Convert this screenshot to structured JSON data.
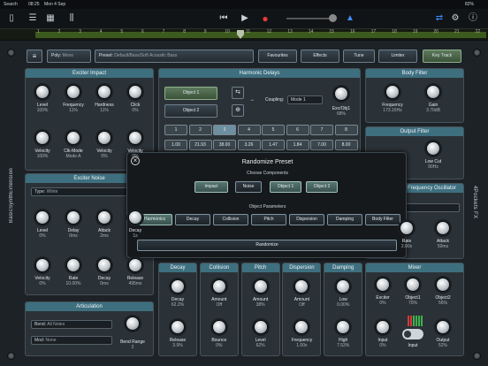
{
  "status": {
    "back": "Search",
    "time": "08:25",
    "date": "Mon 4 Sep",
    "battery": "82%"
  },
  "host": {
    "icons": [
      "document-icon",
      "list-icon",
      "mixer-icon",
      "sliders-icon",
      "rewind-icon",
      "play-icon",
      "record-icon",
      "metronome-icon",
      "wifi-icon",
      "settings-icon",
      "info-icon"
    ]
  },
  "timeline": {
    "ticks": [
      "1",
      "2",
      "3",
      "4",
      "5",
      "6",
      "7",
      "8",
      "9",
      "10",
      "11",
      "12",
      "13",
      "14",
      "15",
      "16",
      "17",
      "18",
      "19",
      "20",
      "21",
      "22"
    ]
  },
  "side": {
    "left": "BasicSynthExtension",
    "right": "4Pockets FX"
  },
  "topbar": {
    "menu": "≡",
    "poly": "Poly:",
    "poly_val": "Mono",
    "preset": "Preset:",
    "preset_val": "Default/Bass/Soft Acoustic Bass",
    "favourites": "Favourites",
    "effects": "Effects",
    "tune": "Tune",
    "limiter": "Limiter",
    "keytrack": "Key Track"
  },
  "exciter_impact": {
    "title": "Exciter Impact",
    "row1": [
      {
        "name": "Level",
        "val": "100%"
      },
      {
        "name": "Frequency",
        "val": "11%"
      },
      {
        "name": "Hardness",
        "val": "11%"
      },
      {
        "name": "Click",
        "val": "0%"
      }
    ],
    "row2": [
      {
        "name": "Velocity",
        "val": "100%"
      },
      {
        "name": "Clk-Mode",
        "val": "Mode A"
      },
      {
        "name": "Velocity",
        "val": "0%"
      },
      {
        "name": "Velocity",
        "val": "0%"
      }
    ]
  },
  "exciter_noise": {
    "title": "Exciter Noise",
    "type_label": "Type:",
    "type_val": "White",
    "row1": [
      {
        "name": "Level",
        "val": "0%"
      },
      {
        "name": "Delay",
        "val": "0ms"
      },
      {
        "name": "Attack",
        "val": "2ms"
      },
      {
        "name": "Decay",
        "val": "1s"
      }
    ],
    "row2": [
      {
        "name": "Velocity",
        "val": "0%"
      },
      {
        "name": "Rate",
        "val": "10.00%"
      },
      {
        "name": "Decay",
        "val": "0ms"
      },
      {
        "name": "Release",
        "val": "495ms"
      }
    ]
  },
  "articulation": {
    "title": "Articulation",
    "bend_label": "Bend:",
    "bend_val": "All Notes",
    "mod_label": "Mod:",
    "mod_val": "None",
    "range_name": "Bend Range",
    "range_val": "2"
  },
  "harmonic_delays": {
    "title": "Harmonic Delays",
    "obj1": "Object 1",
    "obj2": "Object 2",
    "coupling": "Coupling:",
    "coupling_val": "Mode 1",
    "exc_name": "Exc/Obj1",
    "exc_val": "68%",
    "nums": [
      "1",
      "2",
      "3",
      "4",
      "5",
      "6",
      "7",
      "8"
    ],
    "vals": [
      "1.00",
      "21.93",
      "38.00",
      "3.26",
      "1.47",
      "1.84",
      "7.00",
      "8.00"
    ]
  },
  "body_filter": {
    "title": "Body Filter",
    "k": [
      {
        "name": "Frequency",
        "val": "173.16Hz"
      },
      {
        "name": "Gain",
        "val": "3.70dB"
      }
    ]
  },
  "output_filter": {
    "title": "Output Filter",
    "k": {
      "name": "Low Cut",
      "val": "90Hz"
    }
  },
  "freq_osc": {
    "title": "Frequency Oscillator",
    "k": [
      {
        "name": "Rate",
        "val": "2.00x"
      },
      {
        "name": "Attack",
        "val": "50ms"
      }
    ]
  },
  "lower": [
    {
      "title": "Decay",
      "k": [
        {
          "name": "Decay",
          "val": "62.2%"
        },
        {
          "name": "Release",
          "val": "3.9%"
        }
      ]
    },
    {
      "title": "Collision",
      "k": [
        {
          "name": "Amount",
          "val": "Off"
        },
        {
          "name": "Bounce",
          "val": "0%"
        }
      ]
    },
    {
      "title": "Pitch",
      "k": [
        {
          "name": "Amount",
          "val": "38%"
        },
        {
          "name": "Level",
          "val": "62%"
        }
      ]
    },
    {
      "title": "Dispersion",
      "k": [
        {
          "name": "Amount",
          "val": "Off"
        },
        {
          "name": "Frequency",
          "val": "1.00x"
        }
      ]
    },
    {
      "title": "Damping",
      "k": [
        {
          "name": "Low",
          "val": "0.00%"
        },
        {
          "name": "High",
          "val": "7.53%"
        }
      ]
    }
  ],
  "mixer": {
    "title": "Mixer",
    "row1": [
      {
        "name": "Exciter",
        "val": "0%"
      },
      {
        "name": "Object1",
        "val": "70%"
      },
      {
        "name": "Object2",
        "val": "56%"
      }
    ],
    "row2": [
      {
        "name": "Input",
        "val": "0%"
      },
      {
        "name": "Input",
        "val": ""
      },
      {
        "name": "Output",
        "val": "52%"
      }
    ]
  },
  "modal": {
    "close": "×",
    "title": "Randomize Preset",
    "choose": "Choose Components",
    "components": [
      "Impact",
      "Noise",
      "Object 1",
      "Object 2"
    ],
    "params_label": "Object Parameters",
    "params": [
      "Harmonics",
      "Decay",
      "Collision",
      "Pitch",
      "Dispersion",
      "Damping",
      "Body Filter"
    ],
    "randomize": "Randomize"
  }
}
